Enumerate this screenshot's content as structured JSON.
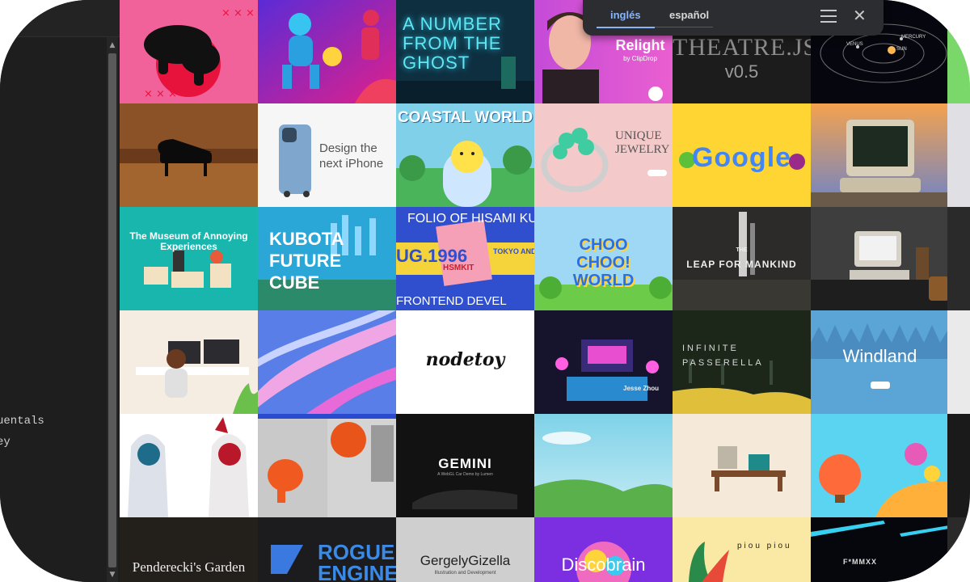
{
  "popup": {
    "tabs": [
      {
        "label": "inglés",
        "active": true
      },
      {
        "label": "español",
        "active": false
      }
    ],
    "menu_icon": "hamburger-menu-icon",
    "close_icon": "close-icon"
  },
  "editor": {
    "lines": [
      "uentals",
      "ey"
    ]
  },
  "gallery": {
    "tiles": {
      "r1c3": "A NUMBER FROM THE GHOST",
      "r1c4_title": "Relight",
      "r1c4_sub": "by ClipDrop",
      "r1c5_title": "THEATRE.JS",
      "r1c5_sub": "v0.5",
      "r1c6_labels": [
        "MERCURY",
        "VENUS",
        "SUN"
      ],
      "r2c2": "Design the next iPhone",
      "r2c3": "COASTAL WORLD",
      "r2c4": "UNIQUE JEWELRY",
      "r2c5": "Google",
      "r3c1": "The Museum of Annoying Experiences",
      "r3c2": "KUBOTA FUTURE CUBE",
      "r3c3_top": "FOLIO OF HISAMI KU",
      "r3c3_mid": "UG.1996",
      "r3c3_side": "TOKYO AND KA",
      "r3c3_bottom": "FRONTEND DEVEL",
      "r3c3_card": "HSMKIT",
      "r3c4": "CHOO CHOO! WORLD",
      "r3c5_small": "THE",
      "r3c5": "LEAP FOR MANKIND",
      "r4c3": "nodetoy",
      "r4c4": "Jesse Zhou",
      "r4c5": "INFINITE PASSERELLA",
      "r4c6": "Windland",
      "r5c3": "GEMINI",
      "r5c3_sub": "A WebGL Car Demo by Lumen",
      "r6c1": "Penderecki's Garden",
      "r6c2": "ROGUE ENGINE",
      "r6c3": "GergelyGizella",
      "r6c3_sub": "Illustration and Development",
      "r6c4": "Discobrain",
      "r6c5": "piou piou",
      "r6c6": "F*MMXX"
    }
  },
  "colors": {
    "accent": "#8ab4f8",
    "popup_bg": "#2b2d31",
    "editor_bg": "#1e1e1e"
  }
}
